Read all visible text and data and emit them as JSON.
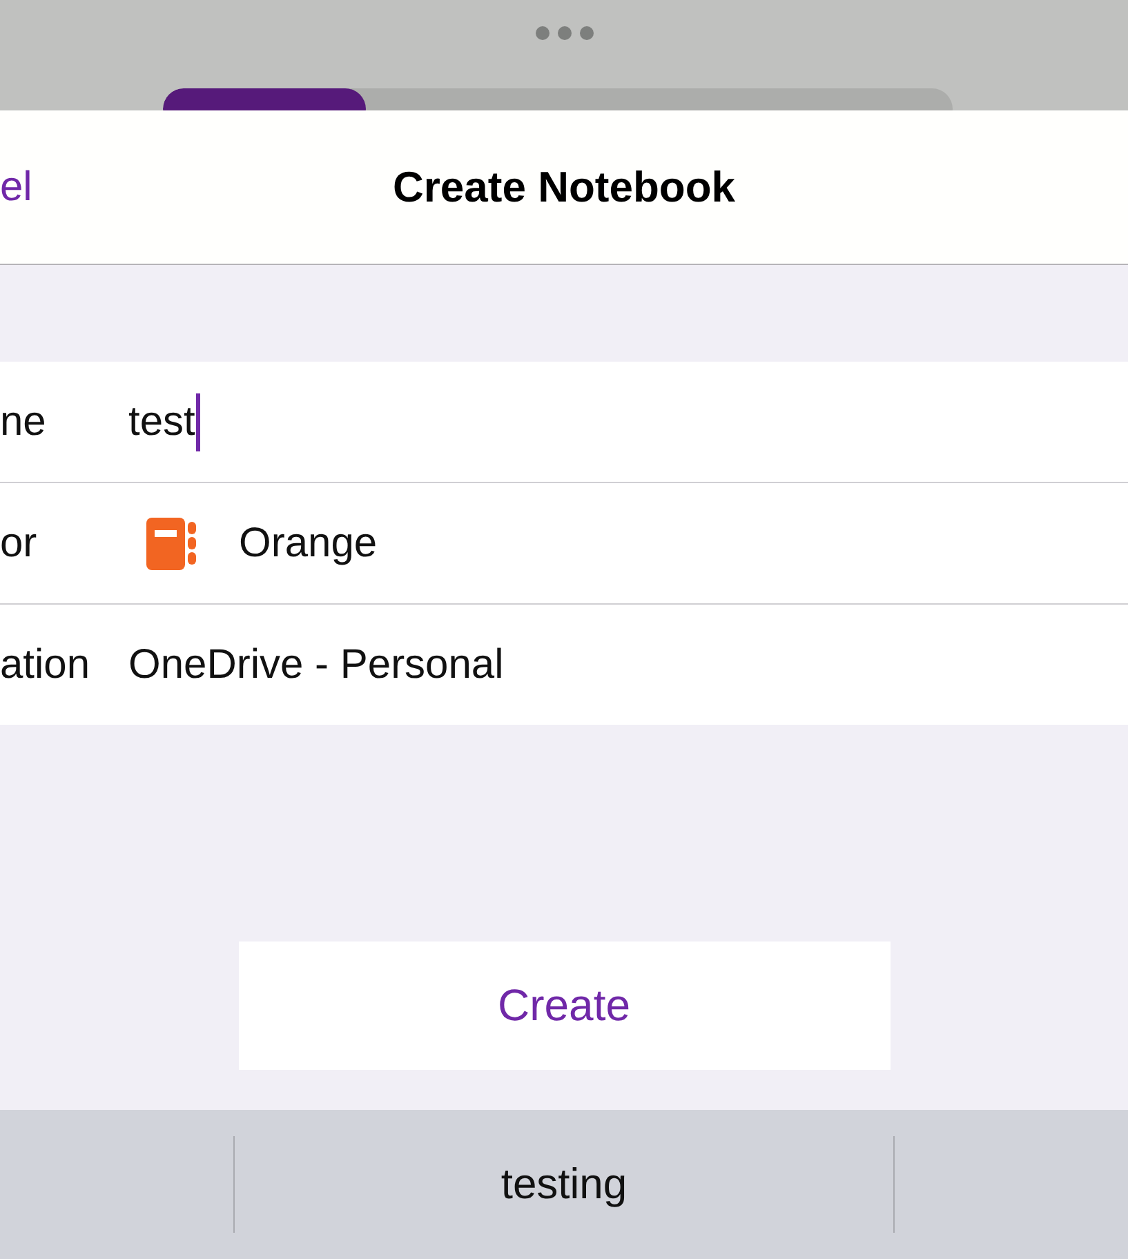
{
  "dialog": {
    "cancel_label": "el",
    "title": "Create Notebook"
  },
  "rows": [
    {
      "kind": "input",
      "label": "ne",
      "value": "test",
      "focused": true
    },
    {
      "kind": "color",
      "label": "or",
      "value": "Orange",
      "color": "#f26522"
    },
    {
      "kind": "text",
      "label": "ation",
      "value": "OneDrive - Personal"
    }
  ],
  "create_button": "Create",
  "suggestion": "testing"
}
